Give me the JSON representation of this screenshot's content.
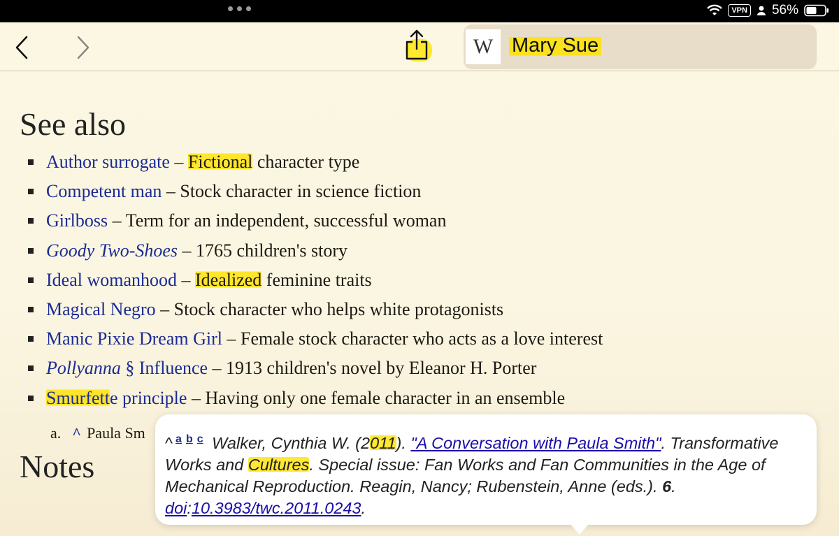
{
  "status": {
    "vpn": "VPN",
    "battery": "56%"
  },
  "toolbar": {
    "site_letter": "W",
    "page_title": "Mary Sue"
  },
  "see_also": {
    "heading": "See also",
    "items": [
      {
        "link": "Author surrogate",
        "sep": " – ",
        "hl": "Fictional",
        "desc": " character type"
      },
      {
        "link": "Competent man",
        "sep": " – ",
        "desc": "Stock character in science fiction"
      },
      {
        "link": "Girlboss",
        "sep": " – ",
        "desc": "Term for an independent, successful woman"
      },
      {
        "link": "Goody Two-Shoes",
        "sep": " – ",
        "desc": "1765 children's story"
      },
      {
        "link": "Ideal womanhood",
        "sep": " – ",
        "hl": "Idealized",
        "desc": " feminine traits"
      },
      {
        "link": "Magical Negro",
        "sep": " – ",
        "desc": "Stock character who helps white protagonists"
      },
      {
        "link": "Manic Pixie Dream Girl",
        "sep": " – ",
        "desc": "Female stock character who acts as a love interest"
      },
      {
        "link_italic": "Pollyanna",
        "link": " § Influence",
        "sep": " – ",
        "desc": "1913 children's novel by Eleanor H. Porter"
      },
      {
        "link_hl": "Smurfett",
        "link": "e principle",
        "sep": " – ",
        "desc": "Having only one female character in an ensemble"
      }
    ]
  },
  "notes": {
    "heading": "Notes",
    "a_label": "a.",
    "a_caret": "^",
    "a_text": "Paula Sm"
  },
  "popover": {
    "caret": "^",
    "sup_a": "a",
    "sup_b": "b",
    "sup_c": "c",
    "author": " Walker, Cynthia W. (2",
    "year_hl": "011",
    "after_year": "). ",
    "title_link": "\"A Conversation with Paula Smith\"",
    "journal_a": ". Transformative Works and ",
    "journal_hl": "Cultures",
    "rest": ". Special issue: Fan Works and Fan Communities in the Age of Mechanical Reproduction. Reagin, Nancy; Rubenstein, Anne (eds.). ",
    "volume": "6",
    "dot": ". ",
    "doi_label": "doi",
    "doi_colon": ":",
    "doi_value": "10.3983/twc.2011.0243",
    "end": "."
  }
}
